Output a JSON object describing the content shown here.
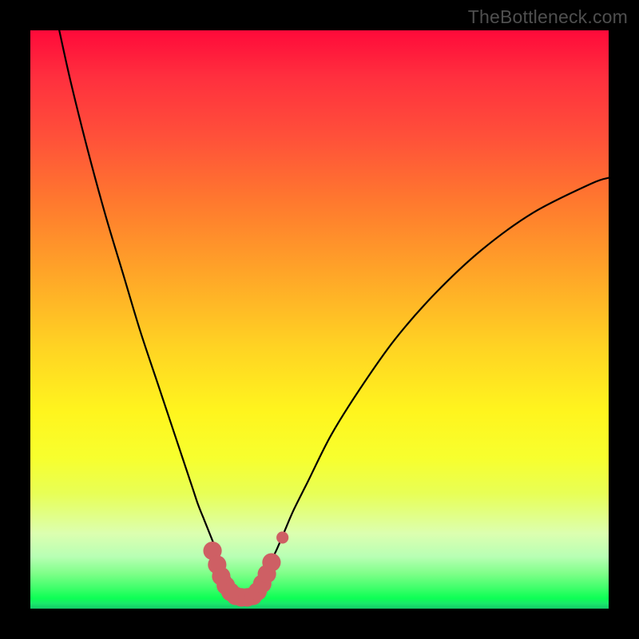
{
  "watermark": "TheBottleneck.com",
  "chart_data": {
    "type": "line",
    "title": "",
    "xlabel": "",
    "ylabel": "",
    "xlim": [
      0,
      100
    ],
    "ylim": [
      0,
      100
    ],
    "grid": false,
    "legend": false,
    "annotations": [],
    "series": [
      {
        "name": "curve",
        "color": "#000000",
        "x": [
          5,
          7,
          10,
          13,
          16,
          19,
          22,
          24,
          26,
          28,
          29,
          30,
          31,
          32,
          33,
          34,
          35,
          36,
          36.7,
          37.2,
          38,
          39,
          40,
          41,
          42.5,
          44,
          45.5,
          48,
          52,
          57,
          63,
          70,
          78,
          87,
          97,
          100
        ],
        "values": [
          100,
          91,
          79,
          68,
          58,
          48,
          39,
          33,
          27,
          21,
          18,
          15.5,
          13,
          10.5,
          8.2,
          6.2,
          4.5,
          3.2,
          2.4,
          2.1,
          2.4,
          3.4,
          5.0,
          7.0,
          10,
          13.5,
          17,
          22,
          30,
          38,
          46.5,
          54.5,
          62,
          68.5,
          73.5,
          74.5
        ]
      },
      {
        "name": "markers",
        "color": "#ce5f64",
        "type": "scatter",
        "points": [
          {
            "x": 31.5,
            "y": 10.0,
            "r": 1.6
          },
          {
            "x": 32.3,
            "y": 7.6,
            "r": 1.6
          },
          {
            "x": 33.0,
            "y": 5.6,
            "r": 1.6
          },
          {
            "x": 33.8,
            "y": 4.0,
            "r": 1.6
          },
          {
            "x": 34.6,
            "y": 2.9,
            "r": 1.6
          },
          {
            "x": 35.5,
            "y": 2.2,
            "r": 1.6
          },
          {
            "x": 36.5,
            "y": 1.95,
            "r": 1.6
          },
          {
            "x": 37.5,
            "y": 1.95,
            "r": 1.6
          },
          {
            "x": 38.5,
            "y": 2.2,
            "r": 1.6
          },
          {
            "x": 39.3,
            "y": 3.0,
            "r": 1.6
          },
          {
            "x": 40.1,
            "y": 4.3,
            "r": 1.6
          },
          {
            "x": 40.9,
            "y": 6.0,
            "r": 1.6
          },
          {
            "x": 41.7,
            "y": 8.0,
            "r": 1.6
          },
          {
            "x": 43.6,
            "y": 12.3,
            "r": 1.05
          }
        ]
      }
    ]
  }
}
